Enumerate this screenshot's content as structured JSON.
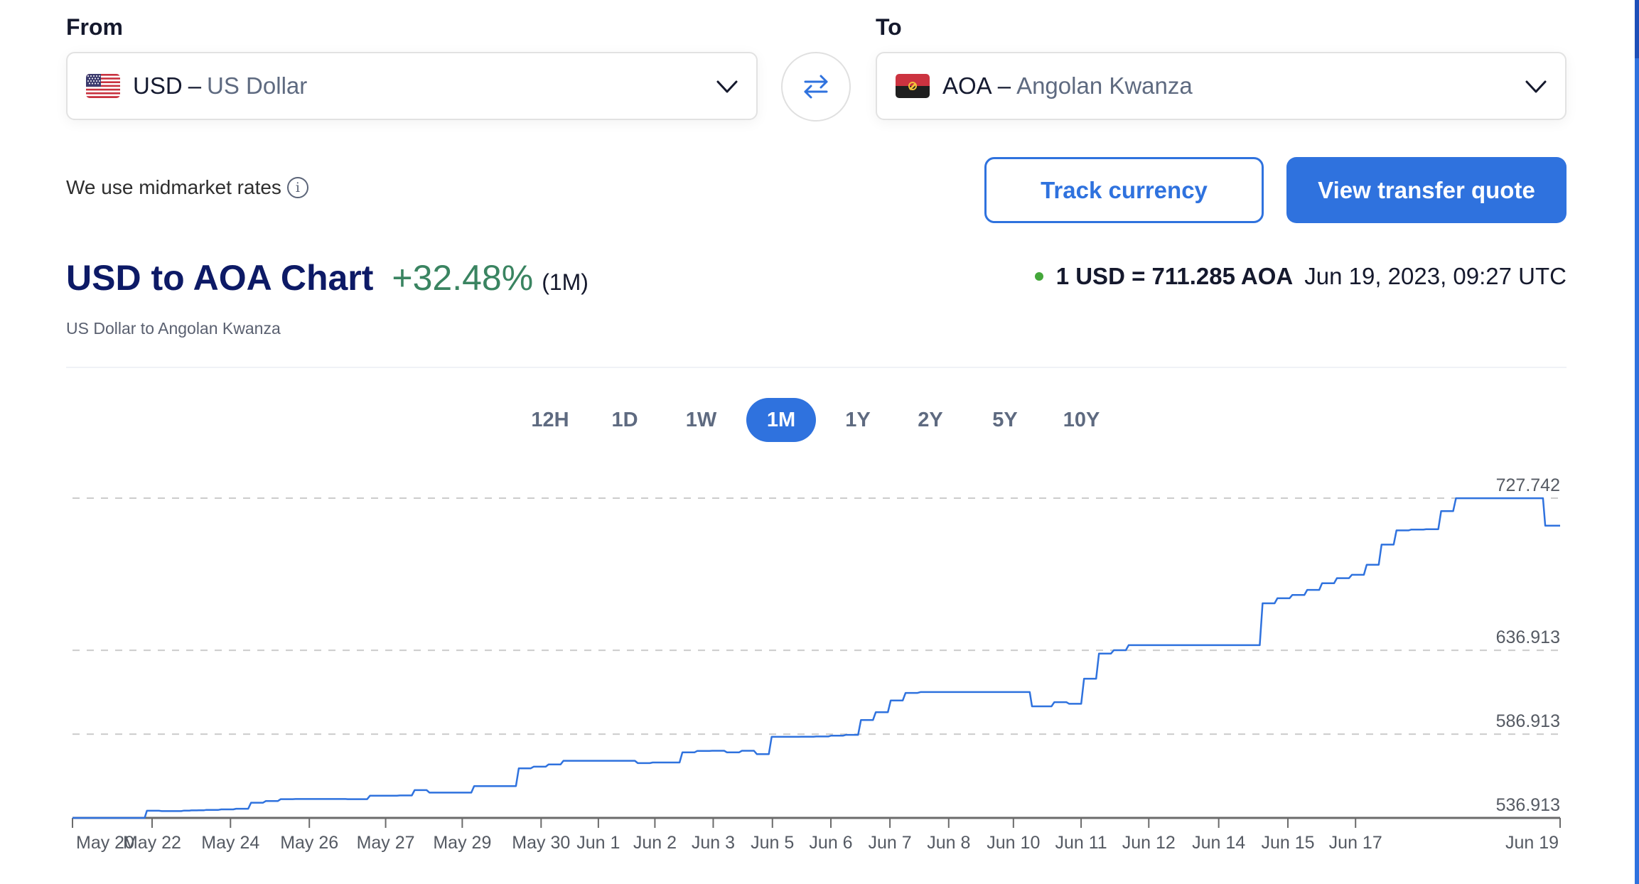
{
  "from": {
    "label": "From",
    "currency_code": "USD",
    "separator": "–",
    "currency_name": "US Dollar",
    "flag_icon": "us-flag-icon"
  },
  "to": {
    "label": "To",
    "currency_code": "AOA",
    "separator": "–",
    "currency_name": "Angolan Kwanza",
    "flag_icon": "angola-flag-icon"
  },
  "swap_icon": "swap-arrows-icon",
  "midmarket_note": "We use midmarket rates",
  "buttons": {
    "track": "Track currency",
    "quote": "View transfer quote"
  },
  "header": {
    "title": "USD to AOA Chart",
    "change": "+32.48%",
    "period": "(1M)",
    "subtitle": "US Dollar to Angolan Kwanza",
    "rate": "1 USD = 711.285 AOA",
    "timestamp": "Jun 19, 2023, 09:27 UTC"
  },
  "tabs": [
    {
      "label": "12H",
      "active": false
    },
    {
      "label": "1D",
      "active": false
    },
    {
      "label": "1W",
      "active": false
    },
    {
      "label": "1M",
      "active": true
    },
    {
      "label": "1Y",
      "active": false
    },
    {
      "label": "2Y",
      "active": false
    },
    {
      "label": "5Y",
      "active": false
    },
    {
      "label": "10Y",
      "active": false
    }
  ],
  "colors": {
    "accent": "#2f72de",
    "title": "#0d1a66",
    "positive": "#3a8461",
    "live_dot": "#44a73a",
    "line": "#2f72de",
    "grid": "#cccccc"
  },
  "chart_data": {
    "type": "line",
    "title": "USD to AOA Chart",
    "xlabel": "",
    "ylabel": "",
    "ylim": [
      536.913,
      727.742
    ],
    "yticks": [
      "727.742",
      "636.913",
      "586.913",
      "536.913"
    ],
    "ytick_values": [
      727.742,
      636.913,
      586.913,
      536.913
    ],
    "xticks": [
      "May 20",
      "May 22",
      "May 24",
      "May 26",
      "May 27",
      "May 29",
      "May 30",
      "Jun 1",
      "Jun 2",
      "Jun 3",
      "Jun 5",
      "Jun 6",
      "Jun 7",
      "Jun 8",
      "Jun 10",
      "Jun 11",
      "Jun 12",
      "Jun 14",
      "Jun 15",
      "Jun 17",
      "Jun 19"
    ],
    "grid": "horizontal-dashed",
    "legend": "none",
    "series": [
      {
        "name": "USD/AOA",
        "x": [
          0,
          0.045,
          0.05,
          0.052,
          0.06,
          0.075,
          0.08,
          0.085,
          0.09,
          0.1,
          0.11,
          0.12,
          0.13,
          0.14,
          0.15,
          0.16,
          0.17,
          0.18,
          0.185,
          0.19,
          0.2,
          0.21,
          0.22,
          0.23,
          0.24,
          0.255,
          0.27,
          0.3,
          0.31,
          0.32,
          0.33,
          0.34,
          0.35,
          0.36,
          0.37,
          0.38,
          0.39,
          0.4,
          0.41,
          0.42,
          0.43,
          0.44,
          0.45,
          0.46,
          0.47,
          0.48,
          0.49,
          0.5,
          0.51,
          0.52,
          0.53,
          0.54,
          0.55,
          0.56,
          0.57,
          0.575,
          0.58,
          0.59,
          0.6,
          0.61,
          0.62,
          0.63,
          0.64,
          0.645,
          0.65,
          0.66,
          0.67,
          0.68,
          0.69,
          0.7,
          0.71,
          0.72,
          0.73,
          0.735,
          0.74,
          0.75,
          0.76,
          0.77,
          0.78,
          0.79,
          0.8,
          0.81,
          0.82,
          0.83,
          0.84,
          0.85,
          0.86,
          0.87,
          0.88,
          0.89,
          0.9,
          0.91,
          0.92,
          0.93,
          0.94,
          0.95,
          0.96,
          0.97,
          0.98,
          0.985,
          0.99,
          0.995,
          1.0
        ],
        "values": [
          536.9,
          536.9,
          541.2,
          541.2,
          541.0,
          541.3,
          541.4,
          541.5,
          541.7,
          542.0,
          542.4,
          546.0,
          547.0,
          548.1,
          548.2,
          548.2,
          548.2,
          548.2,
          548.1,
          548.1,
          550.2,
          550.2,
          550.3,
          553.5,
          552.0,
          552.0,
          555.9,
          566.5,
          567.5,
          568.8,
          571.0,
          571.0,
          571.0,
          571.0,
          571.0,
          569.6,
          570.0,
          570.0,
          576.0,
          576.9,
          577.0,
          576.0,
          577.0,
          575.0,
          585.3,
          585.3,
          585.4,
          585.5,
          586.0,
          586.5,
          595.3,
          600.0,
          607.0,
          611.5,
          612.0,
          612.0,
          612.0,
          612.0,
          612.0,
          612.0,
          612.0,
          612.0,
          612.0,
          603.5,
          603.5,
          606.0,
          605.0,
          620.0,
          635.0,
          637.0,
          640.0,
          640.0,
          640.0,
          640.0,
          640.0,
          640.0,
          640.0,
          640.0,
          640.0,
          640.0,
          665.0,
          668.0,
          670.0,
          673.0,
          677.0,
          680.0,
          682.0,
          688.0,
          700.0,
          708.5,
          709.0,
          709.2,
          720.0,
          727.7,
          727.7,
          727.7,
          727.7,
          727.7,
          727.7,
          727.7,
          711.3,
          711.3,
          711.3
        ]
      }
    ]
  }
}
